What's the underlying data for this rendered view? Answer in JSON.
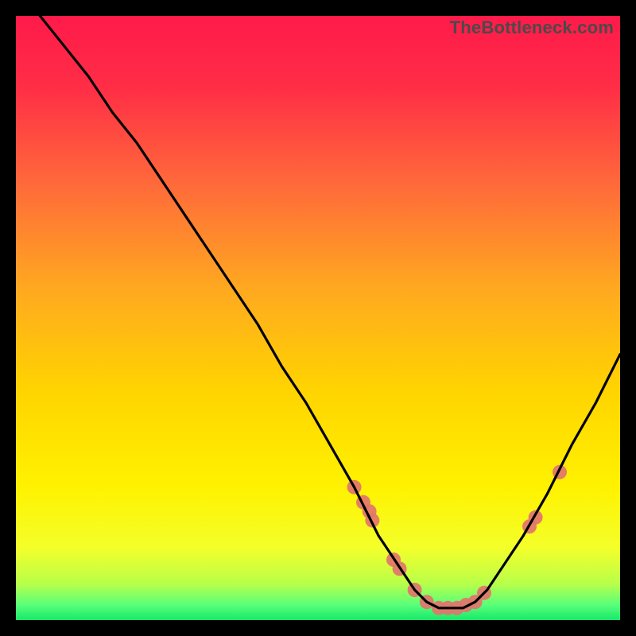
{
  "watermark": "TheBottleneck.com",
  "chart_data": {
    "type": "line",
    "title": "",
    "xlabel": "",
    "ylabel": "",
    "xlim": [
      0,
      100
    ],
    "ylim": [
      0,
      100
    ],
    "curve": {
      "name": "bottleneck-curve",
      "x": [
        0,
        4,
        8,
        12,
        16,
        20,
        24,
        28,
        32,
        36,
        40,
        44,
        48,
        52,
        56,
        60,
        62,
        64,
        66,
        68,
        70,
        72,
        74,
        76,
        78,
        80,
        84,
        88,
        92,
        96,
        100
      ],
      "y": [
        105,
        100,
        95,
        90,
        84,
        79,
        73,
        67,
        61,
        55,
        49,
        42,
        36,
        29,
        22,
        14,
        11,
        8,
        5,
        3,
        2,
        2,
        2,
        3,
        5,
        8,
        14,
        21,
        29,
        36,
        44
      ]
    },
    "markers": {
      "name": "highlight-points",
      "x": [
        56.0,
        57.5,
        58.5,
        59.0,
        62.5,
        63.5,
        66.0,
        68.0,
        70.0,
        71.5,
        73.0,
        74.5,
        76.0,
        77.5,
        85.0,
        86.0,
        90.0
      ],
      "y": [
        22.0,
        19.5,
        18.0,
        16.5,
        10.0,
        8.5,
        5.0,
        3.0,
        2.0,
        2.0,
        2.0,
        2.5,
        3.0,
        4.5,
        15.5,
        17.0,
        24.5
      ]
    },
    "gradient_stops": [
      {
        "offset": 0.0,
        "color": "#ff1a4a"
      },
      {
        "offset": 0.12,
        "color": "#ff2e46"
      },
      {
        "offset": 0.28,
        "color": "#ff6a3a"
      },
      {
        "offset": 0.45,
        "color": "#ffa820"
      },
      {
        "offset": 0.62,
        "color": "#ffd400"
      },
      {
        "offset": 0.78,
        "color": "#fff200"
      },
      {
        "offset": 0.88,
        "color": "#f4ff2a"
      },
      {
        "offset": 0.94,
        "color": "#b8ff4a"
      },
      {
        "offset": 0.975,
        "color": "#58ff7a"
      },
      {
        "offset": 1.0,
        "color": "#18e86a"
      }
    ],
    "marker_style": {
      "radius": 9,
      "fill": "#e2746b",
      "opacity": 0.92
    },
    "curve_style": {
      "stroke": "#000000",
      "width": 3.2
    }
  }
}
